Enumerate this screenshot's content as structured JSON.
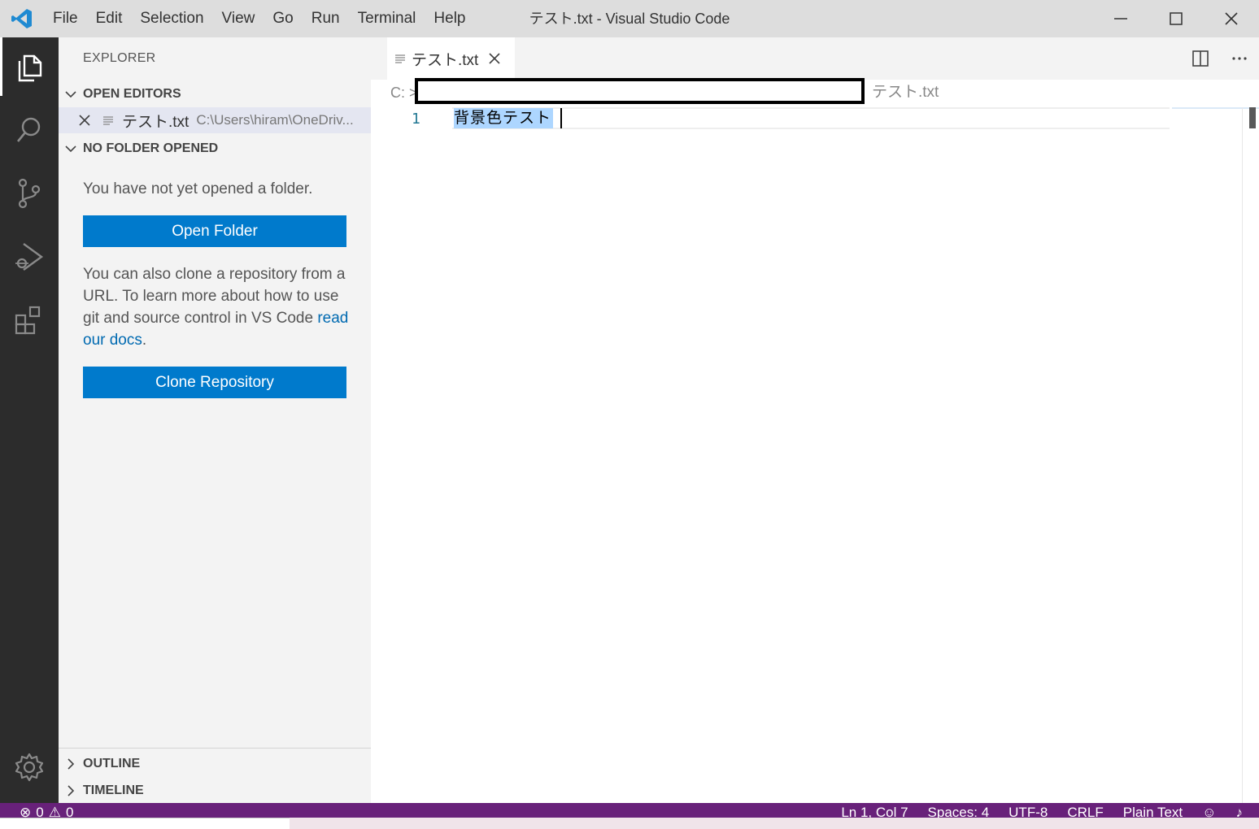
{
  "window": {
    "title": "テスト.txt - Visual Studio Code",
    "menu": [
      "File",
      "Edit",
      "Selection",
      "View",
      "Go",
      "Run",
      "Terminal",
      "Help"
    ]
  },
  "sidebar": {
    "title": "EXPLORER",
    "open_editors": {
      "label": "OPEN EDITORS",
      "items": [
        {
          "name": "テスト.txt",
          "path": "C:\\Users\\hiram\\OneDriv..."
        }
      ]
    },
    "no_folder": {
      "label": "NO FOLDER OPENED",
      "message": "You have not yet opened a folder.",
      "open_folder_button": "Open Folder",
      "clone_text": "You can also clone a repository from a URL. To learn more about how to use git and source control in VS Code ",
      "docs_link": "read our docs",
      "docs_suffix": ".",
      "clone_button": "Clone Repository"
    },
    "outline_label": "OUTLINE",
    "timeline_label": "TIMELINE"
  },
  "editor": {
    "tab_label": "テスト.txt",
    "breadcrumb_prefix": "C: >",
    "breadcrumb_file": "テスト.txt",
    "line_number": "1",
    "line_text": "背景色テスト"
  },
  "status": {
    "errors": "0",
    "warnings": "0",
    "position": "Ln 1, Col 7",
    "spaces": "Spaces: 4",
    "encoding": "UTF-8",
    "eol": "CRLF",
    "language": "Plain Text"
  },
  "colors": {
    "accent": "#007acc",
    "statusbar": "#68217a",
    "activitybar": "#2c2c2c",
    "selection": "#add6ff"
  }
}
